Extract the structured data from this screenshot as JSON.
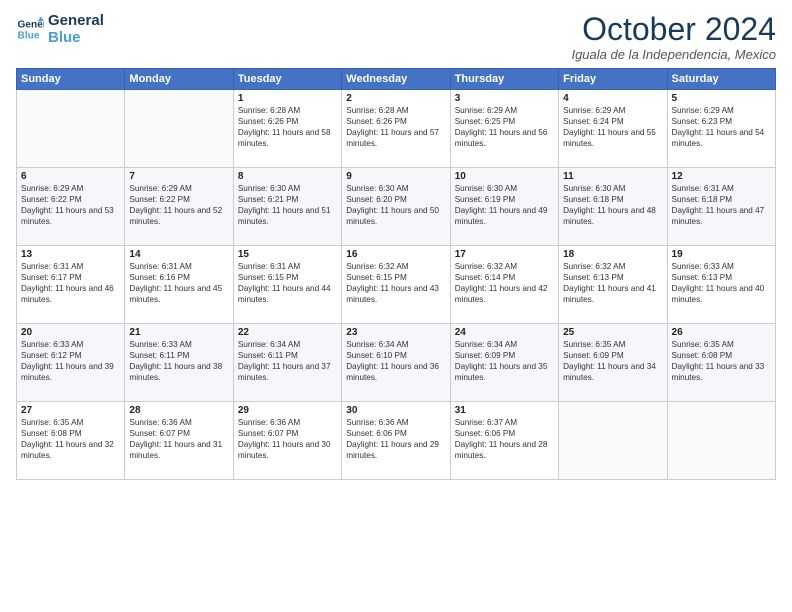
{
  "header": {
    "logo_line1": "General",
    "logo_line2": "Blue",
    "month_title": "October 2024",
    "location": "Iguala de la Independencia, Mexico"
  },
  "weekdays": [
    "Sunday",
    "Monday",
    "Tuesday",
    "Wednesday",
    "Thursday",
    "Friday",
    "Saturday"
  ],
  "weeks": [
    [
      {
        "day": "",
        "info": ""
      },
      {
        "day": "",
        "info": ""
      },
      {
        "day": "1",
        "info": "Sunrise: 6:28 AM\nSunset: 6:26 PM\nDaylight: 11 hours and 58 minutes."
      },
      {
        "day": "2",
        "info": "Sunrise: 6:28 AM\nSunset: 6:26 PM\nDaylight: 11 hours and 57 minutes."
      },
      {
        "day": "3",
        "info": "Sunrise: 6:29 AM\nSunset: 6:25 PM\nDaylight: 11 hours and 56 minutes."
      },
      {
        "day": "4",
        "info": "Sunrise: 6:29 AM\nSunset: 6:24 PM\nDaylight: 11 hours and 55 minutes."
      },
      {
        "day": "5",
        "info": "Sunrise: 6:29 AM\nSunset: 6:23 PM\nDaylight: 11 hours and 54 minutes."
      }
    ],
    [
      {
        "day": "6",
        "info": "Sunrise: 6:29 AM\nSunset: 6:22 PM\nDaylight: 11 hours and 53 minutes."
      },
      {
        "day": "7",
        "info": "Sunrise: 6:29 AM\nSunset: 6:22 PM\nDaylight: 11 hours and 52 minutes."
      },
      {
        "day": "8",
        "info": "Sunrise: 6:30 AM\nSunset: 6:21 PM\nDaylight: 11 hours and 51 minutes."
      },
      {
        "day": "9",
        "info": "Sunrise: 6:30 AM\nSunset: 6:20 PM\nDaylight: 11 hours and 50 minutes."
      },
      {
        "day": "10",
        "info": "Sunrise: 6:30 AM\nSunset: 6:19 PM\nDaylight: 11 hours and 49 minutes."
      },
      {
        "day": "11",
        "info": "Sunrise: 6:30 AM\nSunset: 6:18 PM\nDaylight: 11 hours and 48 minutes."
      },
      {
        "day": "12",
        "info": "Sunrise: 6:31 AM\nSunset: 6:18 PM\nDaylight: 11 hours and 47 minutes."
      }
    ],
    [
      {
        "day": "13",
        "info": "Sunrise: 6:31 AM\nSunset: 6:17 PM\nDaylight: 11 hours and 46 minutes."
      },
      {
        "day": "14",
        "info": "Sunrise: 6:31 AM\nSunset: 6:16 PM\nDaylight: 11 hours and 45 minutes."
      },
      {
        "day": "15",
        "info": "Sunrise: 6:31 AM\nSunset: 6:15 PM\nDaylight: 11 hours and 44 minutes."
      },
      {
        "day": "16",
        "info": "Sunrise: 6:32 AM\nSunset: 6:15 PM\nDaylight: 11 hours and 43 minutes."
      },
      {
        "day": "17",
        "info": "Sunrise: 6:32 AM\nSunset: 6:14 PM\nDaylight: 11 hours and 42 minutes."
      },
      {
        "day": "18",
        "info": "Sunrise: 6:32 AM\nSunset: 6:13 PM\nDaylight: 11 hours and 41 minutes."
      },
      {
        "day": "19",
        "info": "Sunrise: 6:33 AM\nSunset: 6:13 PM\nDaylight: 11 hours and 40 minutes."
      }
    ],
    [
      {
        "day": "20",
        "info": "Sunrise: 6:33 AM\nSunset: 6:12 PM\nDaylight: 11 hours and 39 minutes."
      },
      {
        "day": "21",
        "info": "Sunrise: 6:33 AM\nSunset: 6:11 PM\nDaylight: 11 hours and 38 minutes."
      },
      {
        "day": "22",
        "info": "Sunrise: 6:34 AM\nSunset: 6:11 PM\nDaylight: 11 hours and 37 minutes."
      },
      {
        "day": "23",
        "info": "Sunrise: 6:34 AM\nSunset: 6:10 PM\nDaylight: 11 hours and 36 minutes."
      },
      {
        "day": "24",
        "info": "Sunrise: 6:34 AM\nSunset: 6:09 PM\nDaylight: 11 hours and 35 minutes."
      },
      {
        "day": "25",
        "info": "Sunrise: 6:35 AM\nSunset: 6:09 PM\nDaylight: 11 hours and 34 minutes."
      },
      {
        "day": "26",
        "info": "Sunrise: 6:35 AM\nSunset: 6:08 PM\nDaylight: 11 hours and 33 minutes."
      }
    ],
    [
      {
        "day": "27",
        "info": "Sunrise: 6:35 AM\nSunset: 6:08 PM\nDaylight: 11 hours and 32 minutes."
      },
      {
        "day": "28",
        "info": "Sunrise: 6:36 AM\nSunset: 6:07 PM\nDaylight: 11 hours and 31 minutes."
      },
      {
        "day": "29",
        "info": "Sunrise: 6:36 AM\nSunset: 6:07 PM\nDaylight: 11 hours and 30 minutes."
      },
      {
        "day": "30",
        "info": "Sunrise: 6:36 AM\nSunset: 6:06 PM\nDaylight: 11 hours and 29 minutes."
      },
      {
        "day": "31",
        "info": "Sunrise: 6:37 AM\nSunset: 6:06 PM\nDaylight: 11 hours and 28 minutes."
      },
      {
        "day": "",
        "info": ""
      },
      {
        "day": "",
        "info": ""
      }
    ]
  ]
}
